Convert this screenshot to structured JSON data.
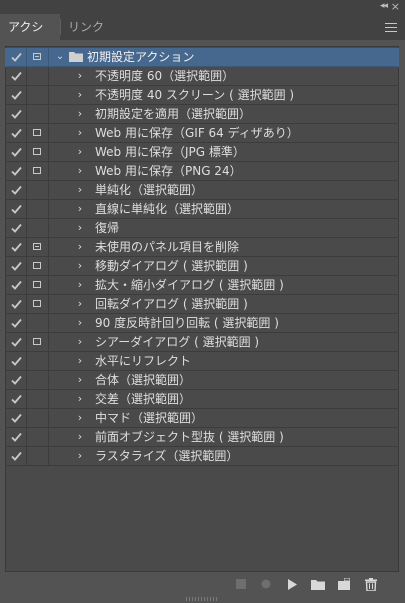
{
  "panel": {
    "tabs": [
      {
        "label": "アクション",
        "active": true
      },
      {
        "label": "リンク",
        "active": false
      }
    ]
  },
  "action_set": {
    "label": "初期設定アクション",
    "checked": true,
    "dialog": "partial",
    "expanded": true
  },
  "actions": [
    {
      "label": "不透明度 60（選択範囲）",
      "checked": true,
      "dialog": "none"
    },
    {
      "label": "不透明度 40 スクリーン ( 選択範囲 )",
      "checked": true,
      "dialog": "none"
    },
    {
      "label": "初期設定を適用（選択範囲）",
      "checked": true,
      "dialog": "none"
    },
    {
      "label": "Web 用に保存（GIF 64 ディザあり）",
      "checked": true,
      "dialog": "on"
    },
    {
      "label": "Web 用に保存（JPG 標準）",
      "checked": true,
      "dialog": "on"
    },
    {
      "label": "Web 用に保存（PNG 24）",
      "checked": true,
      "dialog": "on"
    },
    {
      "label": "単純化（選択範囲）",
      "checked": true,
      "dialog": "none"
    },
    {
      "label": "直線に単純化（選択範囲）",
      "checked": true,
      "dialog": "none"
    },
    {
      "label": "復帰",
      "checked": true,
      "dialog": "none"
    },
    {
      "label": "未使用のパネル項目を削除",
      "checked": true,
      "dialog": "partial"
    },
    {
      "label": "移動ダイアログ ( 選択範囲 )",
      "checked": true,
      "dialog": "on"
    },
    {
      "label": "拡大・縮小ダイアログ ( 選択範囲 )",
      "checked": true,
      "dialog": "on"
    },
    {
      "label": "回転ダイアログ ( 選択範囲 )",
      "checked": true,
      "dialog": "on"
    },
    {
      "label": "90 度反時計回り回転 ( 選択範囲 )",
      "checked": true,
      "dialog": "none"
    },
    {
      "label": "シアーダイアログ ( 選択範囲 )",
      "checked": true,
      "dialog": "on"
    },
    {
      "label": "水平にリフレクト",
      "checked": true,
      "dialog": "none"
    },
    {
      "label": "合体（選択範囲）",
      "checked": true,
      "dialog": "none"
    },
    {
      "label": "交差（選択範囲）",
      "checked": true,
      "dialog": "none"
    },
    {
      "label": "中マド（選択範囲）",
      "checked": true,
      "dialog": "none"
    },
    {
      "label": "前面オブジェクト型抜 ( 選択範囲 )",
      "checked": true,
      "dialog": "none"
    },
    {
      "label": "ラスタライズ（選択範囲）",
      "checked": true,
      "dialog": "none"
    }
  ],
  "footer": {
    "buttons": [
      {
        "icon": "stop-icon",
        "enabled": false
      },
      {
        "icon": "record-icon",
        "enabled": false
      },
      {
        "icon": "play-icon",
        "enabled": true
      },
      {
        "icon": "new-set-folder-icon",
        "enabled": true
      },
      {
        "icon": "new-action-icon",
        "enabled": true
      },
      {
        "icon": "trash-icon",
        "enabled": true
      }
    ]
  },
  "colors": {
    "panel_bg": "#535353",
    "list_bg": "#4a4a4a",
    "selection": "#46688f",
    "text": "#dedede"
  }
}
